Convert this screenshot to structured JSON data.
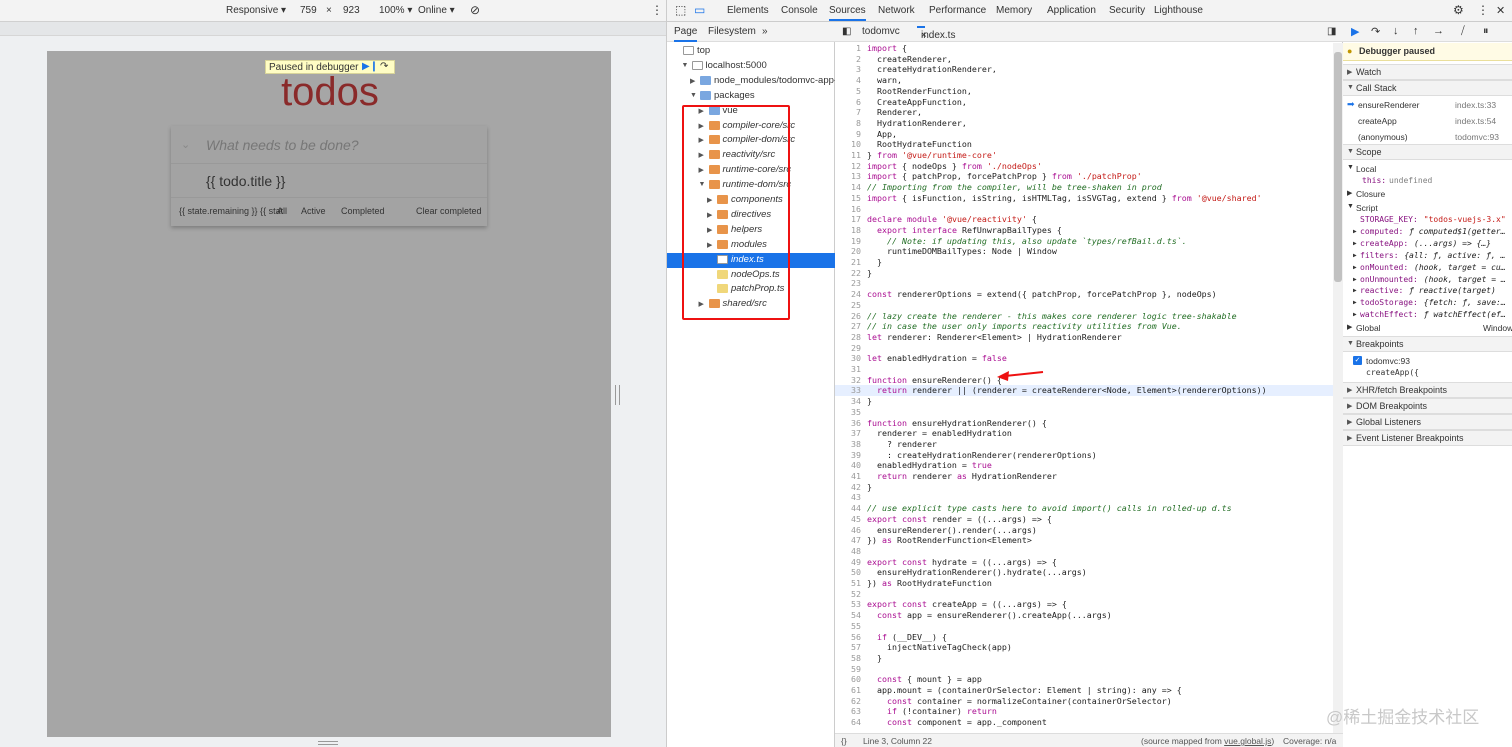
{
  "device_toolbar": {
    "mode": "Responsive",
    "width": "759",
    "times": "×",
    "height": "923",
    "zoom": "100%",
    "network": "Online"
  },
  "page": {
    "paused_label": "Paused in debugger",
    "title": "todos",
    "new_todo_placeholder": "What needs to be done?",
    "todo_item": "{{ todo.title }}",
    "footer_remaining": "{{ state.remaining }} {{ state.remaining | pluralize }}",
    "footer_overlap": "AllremainingActiveTextCompleted",
    "footer_all": "All",
    "footer_active": "Active",
    "footer_completed": "Completed",
    "footer_clear": "Clear completed"
  },
  "devtools_tabs": [
    "Elements",
    "Console",
    "Sources",
    "Network",
    "Performance",
    "Memory",
    "Application",
    "Security",
    "Lighthouse"
  ],
  "active_tab": "Sources",
  "navigator": {
    "tabs": [
      "Page",
      "Filesystem"
    ],
    "more": "»",
    "tree": [
      {
        "label": "top",
        "depth": 0,
        "kind": "frame",
        "open": true
      },
      {
        "label": "localhost:5000",
        "depth": 1,
        "kind": "cloud",
        "open": true
      },
      {
        "label": "node_modules/todomvc-app-css",
        "depth": 2,
        "kind": "folder",
        "open": false
      },
      {
        "label": "packages",
        "depth": 2,
        "kind": "folder",
        "open": true
      },
      {
        "label": "vue",
        "depth": 3,
        "kind": "folder",
        "open": false
      },
      {
        "label": "compiler-core/src",
        "depth": 3,
        "kind": "folder-orange",
        "open": false
      },
      {
        "label": "compiler-dom/src",
        "depth": 3,
        "kind": "folder-orange",
        "open": false
      },
      {
        "label": "reactivity/src",
        "depth": 3,
        "kind": "folder-orange",
        "open": false
      },
      {
        "label": "runtime-core/src",
        "depth": 3,
        "kind": "folder-orange",
        "open": false
      },
      {
        "label": "runtime-dom/src",
        "depth": 3,
        "kind": "folder-orange",
        "open": true
      },
      {
        "label": "components",
        "depth": 4,
        "kind": "folder-orange",
        "open": false
      },
      {
        "label": "directives",
        "depth": 4,
        "kind": "folder-orange",
        "open": false
      },
      {
        "label": "helpers",
        "depth": 4,
        "kind": "folder-orange",
        "open": false
      },
      {
        "label": "modules",
        "depth": 4,
        "kind": "folder-orange",
        "open": false
      },
      {
        "label": "index.ts",
        "depth": 4,
        "kind": "file",
        "selected": true
      },
      {
        "label": "nodeOps.ts",
        "depth": 4,
        "kind": "file-yellow"
      },
      {
        "label": "patchProp.ts",
        "depth": 4,
        "kind": "file-yellow"
      },
      {
        "label": "shared/src",
        "depth": 3,
        "kind": "folder-orange",
        "open": false
      }
    ]
  },
  "editor": {
    "tabs": [
      "todomvc",
      "index.ts"
    ],
    "close": "×",
    "lines": [
      {
        "n": "1",
        "t": "import {"
      },
      {
        "n": "2",
        "t": "  createRenderer,"
      },
      {
        "n": "3",
        "t": "  createHydrationRenderer,"
      },
      {
        "n": "4",
        "t": "  warn,"
      },
      {
        "n": "5",
        "t": "  RootRenderFunction,"
      },
      {
        "n": "6",
        "t": "  CreateAppFunction,"
      },
      {
        "n": "7",
        "t": "  Renderer,"
      },
      {
        "n": "8",
        "t": "  HydrationRenderer,"
      },
      {
        "n": "9",
        "t": "  App,"
      },
      {
        "n": "10",
        "t": "  RootHydrateFunction"
      },
      {
        "n": "11",
        "t": "} from '@vue/runtime-core'"
      },
      {
        "n": "12",
        "t": "import { nodeOps } from './nodeOps'"
      },
      {
        "n": "13",
        "t": "import { patchProp, forcePatchProp } from './patchProp'"
      },
      {
        "n": "14",
        "t": "// Importing from the compiler, will be tree-shaken in prod"
      },
      {
        "n": "15",
        "t": "import { isFunction, isString, isHTMLTag, isSVGTag, extend } from '@vue/shared'"
      },
      {
        "n": "16",
        "t": ""
      },
      {
        "n": "17",
        "t": "declare module '@vue/reactivity' {"
      },
      {
        "n": "18",
        "t": "  export interface RefUnwrapBailTypes {"
      },
      {
        "n": "19",
        "t": "    // Note: if updating this, also update `types/refBail.d.ts`."
      },
      {
        "n": "20",
        "t": "    runtimeDOMBailTypes: Node | Window"
      },
      {
        "n": "21",
        "t": "  }"
      },
      {
        "n": "22",
        "t": "}"
      },
      {
        "n": "23",
        "t": ""
      },
      {
        "n": "24",
        "t": "const rendererOptions = extend({ patchProp, forcePatchProp }, nodeOps)"
      },
      {
        "n": "25",
        "t": ""
      },
      {
        "n": "26",
        "t": "// lazy create the renderer - this makes core renderer logic tree-shakable"
      },
      {
        "n": "27",
        "t": "// in case the user only imports reactivity utilities from Vue."
      },
      {
        "n": "28",
        "t": "let renderer: Renderer<Element> | HydrationRenderer"
      },
      {
        "n": "29",
        "t": ""
      },
      {
        "n": "30",
        "t": "let enabledHydration = false"
      },
      {
        "n": "31",
        "t": ""
      },
      {
        "n": "32",
        "t": "function ensureRenderer() {"
      },
      {
        "n": "33",
        "t": "  return renderer || (renderer = createRenderer<Node, Element>(rendererOptions))"
      },
      {
        "n": "34",
        "t": "}"
      },
      {
        "n": "35",
        "t": ""
      },
      {
        "n": "36",
        "t": "function ensureHydrationRenderer() {"
      },
      {
        "n": "37",
        "t": "  renderer = enabledHydration"
      },
      {
        "n": "38",
        "t": "    ? renderer"
      },
      {
        "n": "39",
        "t": "    : createHydrationRenderer(rendererOptions)"
      },
      {
        "n": "40",
        "t": "  enabledHydration = true"
      },
      {
        "n": "41",
        "t": "  return renderer as HydrationRenderer"
      },
      {
        "n": "42",
        "t": "}"
      },
      {
        "n": "43",
        "t": ""
      },
      {
        "n": "44",
        "t": "// use explicit type casts here to avoid import() calls in rolled-up d.ts"
      },
      {
        "n": "45",
        "t": "export const render = ((...args) => {"
      },
      {
        "n": "46",
        "t": "  ensureRenderer().render(...args)"
      },
      {
        "n": "47",
        "t": "}) as RootRenderFunction<Element>"
      },
      {
        "n": "48",
        "t": ""
      },
      {
        "n": "49",
        "t": "export const hydrate = ((...args) => {"
      },
      {
        "n": "50",
        "t": "  ensureHydrationRenderer().hydrate(...args)"
      },
      {
        "n": "51",
        "t": "}) as RootHydrateFunction"
      },
      {
        "n": "52",
        "t": ""
      },
      {
        "n": "53",
        "t": "export const createApp = ((...args) => {"
      },
      {
        "n": "54",
        "t": "  const app = ensureRenderer().createApp(...args)"
      },
      {
        "n": "55",
        "t": ""
      },
      {
        "n": "56",
        "t": "  if (__DEV__) {"
      },
      {
        "n": "57",
        "t": "    injectNativeTagCheck(app)"
      },
      {
        "n": "58",
        "t": "  }"
      },
      {
        "n": "59",
        "t": ""
      },
      {
        "n": "60",
        "t": "  const { mount } = app"
      },
      {
        "n": "61",
        "t": "  app.mount = (containerOrSelector: Element | string): any => {"
      },
      {
        "n": "62",
        "t": "    const container = normalizeContainer(containerOrSelector)"
      },
      {
        "n": "63",
        "t": "    if (!container) return"
      },
      {
        "n": "64",
        "t": "    const component = app._component"
      }
    ],
    "highlight_line": "33",
    "status_left": "{}",
    "status_pos": "Line 3, Column 22",
    "status_source_prefix": "(source mapped from ",
    "status_source_file": "vue.global.js",
    "status_source_suffix": ")",
    "status_coverage": "Coverage: n/a"
  },
  "sidebar": {
    "debugger_paused": "Debugger paused",
    "watch": "Watch",
    "call_stack": "Call Stack",
    "frames": [
      {
        "name": "ensureRenderer",
        "loc": "index.ts:33",
        "current": true
      },
      {
        "name": "createApp",
        "loc": "index.ts:54"
      },
      {
        "name": "(anonymous)",
        "loc": "todomvc:93"
      }
    ],
    "scope": "Scope",
    "local": "Local",
    "this_key": "this:",
    "this_val": "undefined",
    "closure": "Closure",
    "script": "Script",
    "script_vars": [
      {
        "k": "STORAGE_KEY:",
        "v": "\"todos-vuejs-3.x\""
      },
      {
        "k": "computed:",
        "v": "ƒ computed$1(getter…"
      },
      {
        "k": "createApp:",
        "v": "(...args) => {…}"
      },
      {
        "k": "filters:",
        "v": "{all: ƒ, active: ƒ, …"
      },
      {
        "k": "onMounted:",
        "v": "(hook, target = cu…"
      },
      {
        "k": "onUnmounted:",
        "v": "(hook, target = …"
      },
      {
        "k": "reactive:",
        "v": "ƒ reactive(target)"
      },
      {
        "k": "todoStorage:",
        "v": "{fetch: ƒ, save:…"
      },
      {
        "k": "watchEffect:",
        "v": "ƒ watchEffect(ef…"
      }
    ],
    "global": "Global",
    "global_val": "Window",
    "breakpoints": "Breakpoints",
    "bp_file": "todomvc:93",
    "bp_code": "createApp({",
    "xhr": "XHR/fetch Breakpoints",
    "dom": "DOM Breakpoints",
    "global_listeners": "Global Listeners",
    "event_listeners": "Event Listener Breakpoints"
  },
  "watermark": "@稀土掘金技术社区",
  "colors": {
    "accent": "#1a73e8",
    "todos_red": "#8a2a2a",
    "annotation": "#ee1111"
  }
}
